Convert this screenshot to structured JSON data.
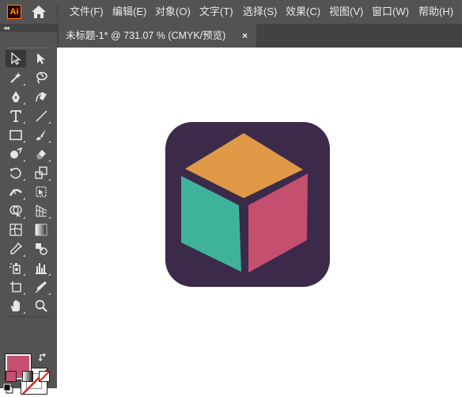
{
  "app": {
    "logo_text": "Ai",
    "logo_color": "#ff9a00",
    "home_icon": "home-icon"
  },
  "menu": [
    {
      "label": "文件(F)"
    },
    {
      "label": "编辑(E)"
    },
    {
      "label": "对象(O)"
    },
    {
      "label": "文字(T)"
    },
    {
      "label": "选择(S)"
    },
    {
      "label": "效果(C)"
    },
    {
      "label": "视图(V)"
    },
    {
      "label": "窗口(W)"
    },
    {
      "label": "帮助(H)"
    }
  ],
  "document_tab": {
    "title": "未标题-1* @ 731.07 % (CMYK/预览)",
    "close_glyph": "×"
  },
  "panel": {
    "collapse_glyph": "◂◂"
  },
  "tools": [
    [
      "selection-tool-icon",
      "direct-selection-tool-icon"
    ],
    [
      "magic-wand-tool-icon",
      "lasso-tool-icon"
    ],
    [
      "pen-tool-icon",
      "curvature-tool-icon"
    ],
    [
      "type-tool-icon",
      "line-segment-tool-icon"
    ],
    [
      "rectangle-tool-icon",
      "paintbrush-tool-icon"
    ],
    [
      "shaper-tool-icon",
      "eraser-tool-icon"
    ],
    [
      "rotate-tool-icon",
      "scale-tool-icon"
    ],
    [
      "width-tool-icon",
      "free-transform-tool-icon"
    ],
    [
      "shape-builder-tool-icon",
      "perspective-grid-tool-icon"
    ],
    [
      "mesh-tool-icon",
      "gradient-tool-icon"
    ],
    [
      "eyedropper-tool-icon",
      "blend-tool-icon"
    ],
    [
      "symbol-sprayer-tool-icon",
      "column-graph-tool-icon"
    ],
    [
      "artboard-tool-icon",
      "slice-tool-icon"
    ],
    [
      "hand-tool-icon",
      "zoom-tool-icon"
    ]
  ],
  "colors": {
    "fill": "#c64f6f",
    "stroke": "none",
    "swap_icon": "swap-arrows-icon",
    "default_icon": "default-colors-icon",
    "modes": [
      "color-mode-icon",
      "gradient-mode-icon",
      "none-mode-icon"
    ]
  },
  "artwork": {
    "background": "#3b2a4a",
    "top_face": "#e09a47",
    "left_face": "#3fb39a",
    "right_face": "#c54f6e"
  }
}
